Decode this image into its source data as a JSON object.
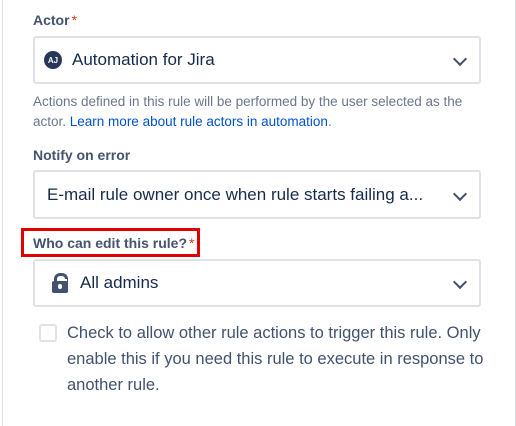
{
  "actor": {
    "label": "Actor",
    "required_mark": "*",
    "avatar_initials": "AJ",
    "value": "Automation for Jira",
    "help_text": "Actions defined in this rule will be performed by the user selected as the actor. ",
    "help_link": "Learn more about rule actors in automation",
    "help_suffix": "."
  },
  "notify": {
    "label": "Notify on error",
    "value": "E-mail rule owner once when rule starts failing a..."
  },
  "editors": {
    "label": "Who can edit this rule?",
    "required_mark": "*",
    "icon": "unlock-icon",
    "value": "All admins"
  },
  "trigger_option": {
    "checked": false,
    "text": "Check to allow other rule actions to trigger this rule. Only enable this if you need this rule to execute in response to another rule."
  },
  "colors": {
    "label": "#44546f",
    "required": "#de350b",
    "link": "#0052cc",
    "highlight": "#e00000"
  }
}
